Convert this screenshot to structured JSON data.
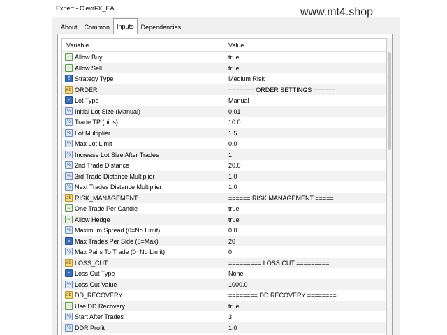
{
  "window": {
    "title": "Expert - ClevrFX_EA"
  },
  "watermark": "www.mt4.shop",
  "tabs": [
    {
      "label": "About",
      "active": false
    },
    {
      "label": "Common",
      "active": false
    },
    {
      "label": "Inputs",
      "active": true
    },
    {
      "label": "Dependencies",
      "active": false
    }
  ],
  "table": {
    "columns": [
      "Variable",
      "Value"
    ],
    "rows": [
      {
        "icon": "bool",
        "variable": "Allow Buy",
        "value": "true"
      },
      {
        "icon": "bool",
        "variable": "Allow Sell",
        "value": "true"
      },
      {
        "icon": "enum",
        "variable": "Strategy Type",
        "value": "Medium Risk"
      },
      {
        "icon": "str",
        "variable": "ORDER",
        "value": "======= ORDER SETTINGS ======"
      },
      {
        "icon": "enum",
        "variable": "Lot Type",
        "value": "Manual"
      },
      {
        "icon": "num",
        "variable": "Initial Lot Size (Manual)",
        "value": "0.01"
      },
      {
        "icon": "num",
        "variable": "Trade TP (pips)",
        "value": "10.0"
      },
      {
        "icon": "num",
        "variable": "Lot Multiplier",
        "value": "1.5"
      },
      {
        "icon": "num",
        "variable": "Max Lot Limit",
        "value": "0.0"
      },
      {
        "icon": "num",
        "variable": "Increase Lot Size After Trades",
        "value": "1"
      },
      {
        "icon": "num",
        "variable": "2nd Trade Distance",
        "value": "20.0"
      },
      {
        "icon": "num",
        "variable": "3rd Trade Distance Multiplier",
        "value": "1.0"
      },
      {
        "icon": "num",
        "variable": "Next Trades Distance Multiplier",
        "value": "1.0"
      },
      {
        "icon": "str",
        "variable": "RISK_MANAGEMENT",
        "value": "====== RISK MANAGEMENT ====="
      },
      {
        "icon": "bool",
        "variable": "One Trade Per Candle",
        "value": "true"
      },
      {
        "icon": "bool",
        "variable": "Allow Hedge",
        "value": "true"
      },
      {
        "icon": "num",
        "variable": "Maximum Spread (0=No Limit)",
        "value": "0.0"
      },
      {
        "icon": "enum",
        "variable": "Max Trades Per Side (0=Max)",
        "value": "20"
      },
      {
        "icon": "num",
        "variable": "Max Pairs To Trade (0=No Limit)",
        "value": "0"
      },
      {
        "icon": "str",
        "variable": "LOSS_CUT",
        "value": "========= LOSS CUT ========="
      },
      {
        "icon": "enum",
        "variable": "Loss Cut Type",
        "value": "None"
      },
      {
        "icon": "num",
        "variable": "Loss Cut Value",
        "value": "1000.0"
      },
      {
        "icon": "str",
        "variable": "DD_RECOVERY",
        "value": "======== DD RECOVERY ========"
      },
      {
        "icon": "bool",
        "variable": "Use DD Recovery",
        "value": "true"
      },
      {
        "icon": "num",
        "variable": "Start After Trades",
        "value": "3"
      },
      {
        "icon": "num",
        "variable": "DDR Profit",
        "value": "1.0"
      }
    ]
  },
  "icon_glyphs": {
    "bool": "~",
    "enum": "E",
    "num": "½",
    "str": "ab"
  }
}
